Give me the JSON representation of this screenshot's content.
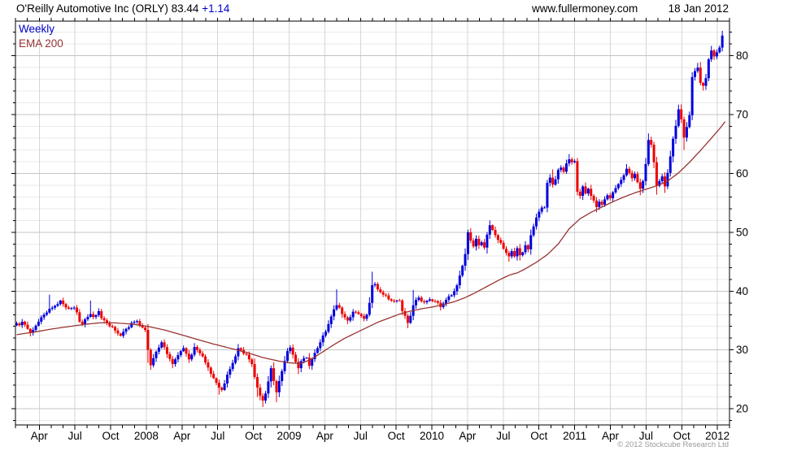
{
  "header": {
    "title": "O'Reilly Automotive Inc (ORLY)",
    "last_price": "83.44",
    "change": "+1.14",
    "website": "www.fullermoney.com",
    "date": "18 Jan 2012"
  },
  "legend": {
    "series_label": "Weekly",
    "ema_label": "EMA 200"
  },
  "footer": {
    "copyright": "© 2012 Stockcube Research Ltd"
  },
  "colors": {
    "up": "#0000dd",
    "down": "#ee0000",
    "ema": "#993333",
    "grid_major": "#c4c4c4",
    "grid_minor": "#eaeaea",
    "grid_vertical": "#d6d6d6",
    "axis": "#000000",
    "accent_blue": "#0000cc",
    "copyright_gray": "#9a9a9a"
  },
  "chart_data": {
    "type": "candlestick",
    "interval": "weekly",
    "instrument": "O'Reilly Automotive Inc (ORLY)",
    "last_price": 83.44,
    "change": 1.14,
    "as_of": "18 Jan 2012",
    "overlay": "EMA 200",
    "y_axis": {
      "side": "right",
      "min": 17.3,
      "max": 85.9,
      "major_ticks": [
        20,
        30,
        40,
        50,
        60,
        70,
        80
      ],
      "minor_step": 2
    },
    "x_axis": {
      "start_month": "Feb 2007",
      "end_month": "Feb 2012",
      "months_total": 60,
      "gridline_every_months": 3,
      "tick_every_months": 1,
      "labels": [
        {
          "m": 2,
          "t": "Apr"
        },
        {
          "m": 5,
          "t": "Jul"
        },
        {
          "m": 8,
          "t": "Oct"
        },
        {
          "m": 11,
          "t": "2008"
        },
        {
          "m": 14,
          "t": "Apr"
        },
        {
          "m": 17,
          "t": "Jul"
        },
        {
          "m": 20,
          "t": "Oct"
        },
        {
          "m": 23,
          "t": "2009"
        },
        {
          "m": 26,
          "t": "Apr"
        },
        {
          "m": 29,
          "t": "Jul"
        },
        {
          "m": 32,
          "t": "Oct"
        },
        {
          "m": 35,
          "t": "2010"
        },
        {
          "m": 38,
          "t": "Apr"
        },
        {
          "m": 41,
          "t": "Jul"
        },
        {
          "m": 44,
          "t": "Oct"
        },
        {
          "m": 47,
          "t": "2011"
        },
        {
          "m": 50,
          "t": "Apr"
        },
        {
          "m": 53,
          "t": "Jul"
        },
        {
          "m": 56,
          "t": "Oct"
        },
        {
          "m": 59,
          "t": "2012"
        }
      ]
    },
    "weeks_total": 259,
    "price_close_anchors": [
      [
        0,
        34.5
      ],
      [
        1,
        34.2
      ],
      [
        2,
        34.8
      ],
      [
        3,
        34.3
      ],
      [
        5,
        32.9
      ],
      [
        6,
        33.4
      ],
      [
        8,
        34.8
      ],
      [
        10,
        36.0
      ],
      [
        12,
        37.0
      ],
      [
        14,
        37.5
      ],
      [
        16,
        38.4
      ],
      [
        17,
        37.8
      ],
      [
        19,
        37.0
      ],
      [
        21,
        37.2
      ],
      [
        22,
        36.4
      ],
      [
        23,
        34.8
      ],
      [
        24,
        34.4
      ],
      [
        25,
        35.2
      ],
      [
        27,
        36.1
      ],
      [
        28,
        35.6
      ],
      [
        30,
        36.6
      ],
      [
        31,
        35.4
      ],
      [
        33,
        34.6
      ],
      [
        35,
        33.9
      ],
      [
        37,
        32.8
      ],
      [
        38,
        32.4
      ],
      [
        40,
        33.6
      ],
      [
        42,
        34.6
      ],
      [
        44,
        34.9
      ],
      [
        45,
        34.2
      ],
      [
        46,
        33.8
      ],
      [
        47,
        33.4
      ],
      [
        48,
        30.0
      ],
      [
        49,
        27.4
      ],
      [
        50,
        28.6
      ],
      [
        52,
        30.4
      ],
      [
        53,
        31.3
      ],
      [
        55,
        29.3
      ],
      [
        57,
        27.6
      ],
      [
        58,
        28.4
      ],
      [
        60,
        29.8
      ],
      [
        61,
        30.3
      ],
      [
        63,
        28.4
      ],
      [
        65,
        30.5
      ],
      [
        66,
        30.0
      ],
      [
        68,
        28.9
      ],
      [
        70,
        27.0
      ],
      [
        72,
        25.2
      ],
      [
        74,
        23.6
      ],
      [
        75,
        23.2
      ],
      [
        77,
        25.8
      ],
      [
        79,
        27.8
      ],
      [
        81,
        30.3
      ],
      [
        82,
        30.0
      ],
      [
        84,
        29.2
      ],
      [
        86,
        27.6
      ],
      [
        88,
        23.6
      ],
      [
        89,
        22.2
      ],
      [
        90,
        21.4
      ],
      [
        91,
        22.6
      ],
      [
        93,
        26.9
      ],
      [
        95,
        22.8
      ],
      [
        97,
        26.4
      ],
      [
        99,
        29.8
      ],
      [
        100,
        30.4
      ],
      [
        101,
        29.2
      ],
      [
        103,
        26.9
      ],
      [
        104,
        28.1
      ],
      [
        106,
        28.7
      ],
      [
        107,
        27.3
      ],
      [
        109,
        29.5
      ],
      [
        111,
        31.3
      ],
      [
        113,
        33.1
      ],
      [
        115,
        35.7
      ],
      [
        116,
        36.9
      ],
      [
        117,
        37.6
      ],
      [
        118,
        37.2
      ],
      [
        119,
        36.1
      ],
      [
        121,
        35.0
      ],
      [
        123,
        36.5
      ],
      [
        125,
        36.1
      ],
      [
        127,
        35.3
      ],
      [
        128,
        36.0
      ],
      [
        129,
        38.0
      ],
      [
        130,
        41.0
      ],
      [
        131,
        41.2
      ],
      [
        132,
        40.3
      ],
      [
        134,
        39.4
      ],
      [
        136,
        38.6
      ],
      [
        138,
        38.3
      ],
      [
        140,
        38.4
      ],
      [
        141,
        36.6
      ],
      [
        143,
        34.6
      ],
      [
        144,
        35.8
      ],
      [
        145,
        37.6
      ],
      [
        146,
        38.5
      ],
      [
        147,
        38.9
      ],
      [
        149,
        38.1
      ],
      [
        151,
        38.6
      ],
      [
        153,
        38.3
      ],
      [
        155,
        37.3
      ],
      [
        157,
        38.5
      ],
      [
        159,
        39.3
      ],
      [
        161,
        41.0
      ],
      [
        163,
        44.3
      ],
      [
        164,
        46.3
      ],
      [
        165,
        50.0
      ],
      [
        166,
        48.6
      ],
      [
        167,
        47.6
      ],
      [
        168,
        48.9
      ],
      [
        169,
        47.8
      ],
      [
        170,
        48.3
      ],
      [
        171,
        47.4
      ],
      [
        172,
        49.6
      ],
      [
        173,
        51.2
      ],
      [
        174,
        50.4
      ],
      [
        176,
        48.7
      ],
      [
        178,
        47.2
      ],
      [
        180,
        45.9
      ],
      [
        181,
        46.8
      ],
      [
        182,
        45.9
      ],
      [
        183,
        47.3
      ],
      [
        184,
        46.1
      ],
      [
        185,
        46.6
      ],
      [
        186,
        47.8
      ],
      [
        187,
        47.1
      ],
      [
        188,
        49.5
      ],
      [
        189,
        51.0
      ],
      [
        190,
        52.5
      ],
      [
        191,
        53.5
      ],
      [
        192,
        54.2
      ],
      [
        193,
        54.2
      ],
      [
        194,
        58.4
      ],
      [
        195,
        59.3
      ],
      [
        196,
        58.1
      ],
      [
        197,
        59.0
      ],
      [
        198,
        60.6
      ],
      [
        199,
        61.0
      ],
      [
        200,
        60.3
      ],
      [
        201,
        61.7
      ],
      [
        202,
        62.4
      ],
      [
        203,
        61.9
      ],
      [
        204,
        62.1
      ],
      [
        205,
        56.9
      ],
      [
        206,
        56.2
      ],
      [
        207,
        57.8
      ],
      [
        208,
        56.6
      ],
      [
        209,
        57.4
      ],
      [
        210,
        56.2
      ],
      [
        211,
        55.4
      ],
      [
        212,
        54.3
      ],
      [
        213,
        55.2
      ],
      [
        214,
        54.7
      ],
      [
        215,
        55.6
      ],
      [
        216,
        56.3
      ],
      [
        217,
        55.8
      ],
      [
        218,
        56.8
      ],
      [
        219,
        57.5
      ],
      [
        220,
        58.2
      ],
      [
        221,
        58.9
      ],
      [
        222,
        59.7
      ],
      [
        223,
        60.8
      ],
      [
        224,
        60.1
      ],
      [
        225,
        59.2
      ],
      [
        226,
        59.9
      ],
      [
        227,
        58.5
      ],
      [
        228,
        57.4
      ],
      [
        229,
        58.7
      ],
      [
        230,
        61.6
      ],
      [
        231,
        65.7
      ],
      [
        232,
        64.9
      ],
      [
        233,
        61.9
      ],
      [
        234,
        57.9
      ],
      [
        235,
        58.7
      ],
      [
        236,
        59.5
      ],
      [
        237,
        57.8
      ],
      [
        238,
        60.1
      ],
      [
        239,
        62.9
      ],
      [
        240,
        65.9
      ],
      [
        241,
        68.1
      ],
      [
        242,
        70.9
      ],
      [
        243,
        69.2
      ],
      [
        244,
        66.1
      ],
      [
        245,
        67.9
      ],
      [
        246,
        69.9
      ],
      [
        247,
        76.4
      ],
      [
        248,
        77.4
      ],
      [
        249,
        78.0
      ],
      [
        250,
        75.4
      ],
      [
        251,
        74.9
      ],
      [
        252,
        76.2
      ],
      [
        253,
        79.4
      ],
      [
        254,
        80.9
      ],
      [
        255,
        79.9
      ],
      [
        256,
        80.6
      ],
      [
        257,
        81.4
      ],
      [
        258,
        83.44
      ]
    ],
    "high_spikes": [
      [
        12,
        39.4
      ],
      [
        27,
        38.4
      ],
      [
        117,
        40.3
      ],
      [
        130,
        43.3
      ],
      [
        145,
        40.2
      ],
      [
        165,
        50.4
      ],
      [
        173,
        51.8
      ],
      [
        196,
        60.7
      ],
      [
        202,
        63.3
      ],
      [
        223,
        61.6
      ],
      [
        231,
        66.8
      ],
      [
        242,
        71.7
      ],
      [
        247,
        77.2
      ],
      [
        249,
        78.8
      ],
      [
        254,
        81.6
      ],
      [
        258,
        83.9
      ]
    ],
    "low_spikes": [
      [
        5,
        32.3
      ],
      [
        48,
        27.8
      ],
      [
        49,
        26.6
      ],
      [
        57,
        26.9
      ],
      [
        74,
        22.4
      ],
      [
        88,
        22.0
      ],
      [
        90,
        20.3
      ],
      [
        91,
        20.9
      ],
      [
        95,
        21.1
      ],
      [
        103,
        25.9
      ],
      [
        107,
        26.8
      ],
      [
        121,
        34.4
      ],
      [
        143,
        33.7
      ],
      [
        155,
        36.7
      ],
      [
        180,
        45.0
      ],
      [
        184,
        45.2
      ],
      [
        205,
        56.5
      ],
      [
        212,
        53.4
      ],
      [
        228,
        56.3
      ],
      [
        234,
        56.4
      ],
      [
        237,
        56.7
      ],
      [
        244,
        64.0
      ],
      [
        251,
        74.1
      ]
    ],
    "ema_anchors": [
      [
        0,
        32.6
      ],
      [
        6,
        33.0
      ],
      [
        12,
        33.5
      ],
      [
        18,
        33.9
      ],
      [
        24,
        34.3
      ],
      [
        30,
        34.6
      ],
      [
        36,
        34.6
      ],
      [
        42,
        34.4
      ],
      [
        48,
        34.0
      ],
      [
        54,
        33.4
      ],
      [
        60,
        32.6
      ],
      [
        66,
        31.8
      ],
      [
        72,
        31.0
      ],
      [
        78,
        30.3
      ],
      [
        84,
        29.6
      ],
      [
        90,
        28.7
      ],
      [
        96,
        28.1
      ],
      [
        100,
        27.8
      ],
      [
        104,
        27.7
      ],
      [
        108,
        28.5
      ],
      [
        112,
        29.7
      ],
      [
        116,
        30.9
      ],
      [
        120,
        32.0
      ],
      [
        124,
        32.9
      ],
      [
        128,
        33.8
      ],
      [
        132,
        34.7
      ],
      [
        136,
        35.4
      ],
      [
        140,
        36.1
      ],
      [
        144,
        36.6
      ],
      [
        148,
        37.0
      ],
      [
        152,
        37.3
      ],
      [
        156,
        37.7
      ],
      [
        160,
        38.2
      ],
      [
        164,
        38.9
      ],
      [
        168,
        39.8
      ],
      [
        172,
        40.8
      ],
      [
        176,
        41.8
      ],
      [
        180,
        42.7
      ],
      [
        183,
        43.1
      ],
      [
        186,
        43.8
      ],
      [
        190,
        44.9
      ],
      [
        194,
        46.2
      ],
      [
        198,
        48.0
      ],
      [
        202,
        50.6
      ],
      [
        206,
        52.3
      ],
      [
        210,
        53.4
      ],
      [
        214,
        54.3
      ],
      [
        218,
        55.2
      ],
      [
        222,
        56.0
      ],
      [
        226,
        56.7
      ],
      [
        230,
        57.3
      ],
      [
        234,
        57.9
      ],
      [
        238,
        58.7
      ],
      [
        242,
        60.1
      ],
      [
        246,
        61.9
      ],
      [
        250,
        63.9
      ],
      [
        254,
        66.0
      ],
      [
        257,
        67.6
      ],
      [
        259,
        68.8
      ]
    ]
  }
}
